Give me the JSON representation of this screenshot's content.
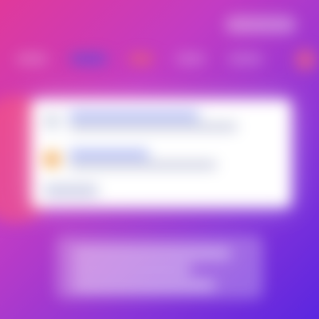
{
  "theme": {
    "gradient_start": "#e0399b",
    "gradient_mid": "#c23cc4",
    "gradient_end": "#5b26e0",
    "card_background": "#ffffff",
    "accent": "#8f9df0"
  },
  "header": {
    "action_label": ""
  },
  "nav": {
    "items": [
      "",
      "",
      "",
      "",
      ""
    ]
  },
  "card": {
    "rows": [
      {
        "avatar_color": "#d7dbe8",
        "title": "",
        "subtitle": ""
      },
      {
        "avatar_color": "#f2b36b",
        "title": "",
        "subtitle": ""
      }
    ]
  },
  "footer": {
    "text": ""
  }
}
